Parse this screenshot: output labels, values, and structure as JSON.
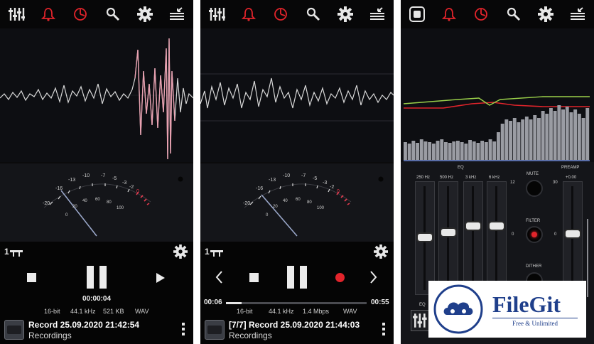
{
  "colors": {
    "accent_red": "#e2242b",
    "panel_bg": "#0b0b0c",
    "wave_color": "#dcdcdc",
    "wave_peak": "#e8a0b0",
    "vu_red": "#e43b4f",
    "logo_blue": "#1f3f8b"
  },
  "toolbar_icons": [
    "eq-sliders-icon",
    "bell-icon",
    "clock-pie-icon",
    "magnifier-icon",
    "gear-icon",
    "stack-arrow-icon"
  ],
  "screen1": {
    "vu_scale": [
      "-20",
      "-16",
      "-13",
      "-10",
      "-7",
      "-5",
      "-3",
      "-2",
      "0",
      "20",
      "40",
      "60",
      "80",
      "100"
    ],
    "elapsed": "00:00:04",
    "bit_depth": "16-bit",
    "sample_rate": "44.1 kHz",
    "file_size": "521 KB",
    "format": "WAV",
    "record_title": "Record 25.09.2020 21:42:54",
    "record_folder": "Recordings"
  },
  "screen2": {
    "vu_scale": [
      "-20",
      "-16",
      "-13",
      "-10",
      "-7",
      "-5",
      "-3",
      "-2",
      "0",
      "20",
      "40",
      "60",
      "80",
      "100"
    ],
    "position": "00:06",
    "duration": "00:55",
    "progress": 0.11,
    "bit_depth": "16-bit",
    "sample_rate": "44.1 kHz",
    "bitrate": "1.4 Mbps",
    "format": "WAV",
    "record_title": "[7/7] Record 25.09.2020 21:44:03",
    "record_folder": "Recordings"
  },
  "screen3": {
    "eq_label": "EQ",
    "bands": [
      {
        "label": "250 Hz",
        "level": 0.48
      },
      {
        "label": "500 Hz",
        "level": 0.43
      },
      {
        "label": "3 kHz",
        "level": 0.36
      },
      {
        "label": "6 kHz",
        "level": 0.36
      }
    ],
    "mute_label": "MUTE",
    "filter_label": "FILTER",
    "dither_label": "DITHER",
    "preamp_label": "PREAMP",
    "preamp_value": "+0.00",
    "scale_top": "12",
    "scale_mid": "0",
    "preamp_top": "30",
    "preamp_mid": "0",
    "eq_bottom_label": "EQ"
  },
  "logo": {
    "name": "FileGit",
    "tagline": "Free & Unlimited"
  }
}
